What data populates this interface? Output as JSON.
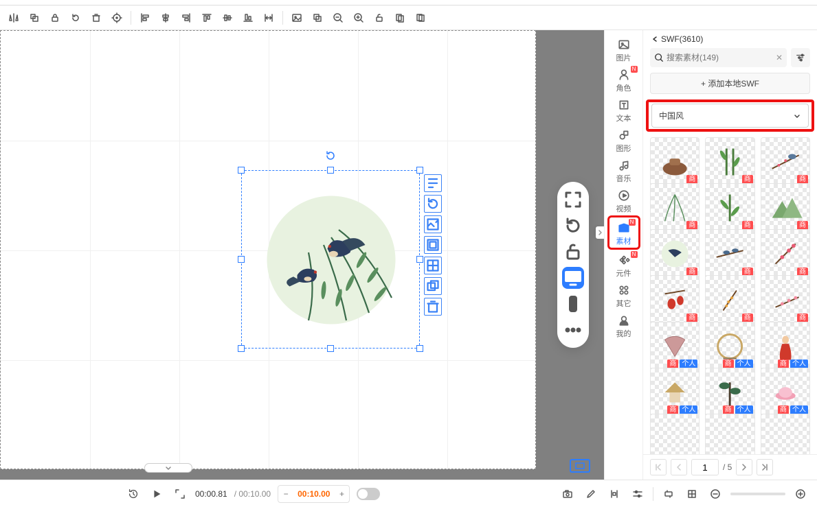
{
  "toolbar_icons": [
    "flip-h",
    "send-back",
    "lock-a",
    "refresh",
    "trash",
    "target",
    "spacer",
    "align-left",
    "align-hcenter",
    "align-right",
    "align-top",
    "align-vcenter",
    "align-bottom",
    "dist-equal",
    "spacer",
    "image",
    "bring-front",
    "zoom-out",
    "zoom-in",
    "unlock",
    "copy",
    "layers"
  ],
  "categories": [
    {
      "key": "image",
      "label": "图片",
      "n": false
    },
    {
      "key": "role",
      "label": "角色",
      "n": true
    },
    {
      "key": "text",
      "label": "文本",
      "n": false
    },
    {
      "key": "shape",
      "label": "图形",
      "n": false
    },
    {
      "key": "music",
      "label": "音乐",
      "n": false
    },
    {
      "key": "video",
      "label": "视频",
      "n": false
    },
    {
      "key": "asset",
      "label": "素材",
      "n": true,
      "active": true,
      "highlight": true
    },
    {
      "key": "component",
      "label": "元件",
      "n": true
    },
    {
      "key": "other",
      "label": "其它",
      "n": false
    },
    {
      "key": "mine",
      "label": "我的",
      "n": false
    }
  ],
  "panel": {
    "back_title": "SWF(3610)",
    "search_placeholder": "搜索素材(149)",
    "add_label": "+ 添加本地SWF",
    "style_select": "中国风",
    "badges": {
      "com": "商",
      "per": "个人"
    },
    "thumbs": [
      {
        "t": "teapot",
        "b": [
          "com"
        ]
      },
      {
        "t": "bamboo",
        "b": [
          "com"
        ]
      },
      {
        "t": "bird-plum",
        "b": [
          "com"
        ]
      },
      {
        "t": "willow",
        "b": [
          "com"
        ]
      },
      {
        "t": "bamboo2",
        "b": [
          "com"
        ]
      },
      {
        "t": "mountain",
        "b": [
          "com"
        ]
      },
      {
        "t": "swallow",
        "b": [
          "com"
        ]
      },
      {
        "t": "birds-branch",
        "b": [
          "com"
        ]
      },
      {
        "t": "plum2",
        "b": [
          "com"
        ]
      },
      {
        "t": "lantern",
        "b": [
          "com"
        ]
      },
      {
        "t": "osmanthus",
        "b": [
          "com"
        ]
      },
      {
        "t": "plum3",
        "b": [
          "com"
        ]
      },
      {
        "t": "fan",
        "b": [
          "com",
          "per"
        ]
      },
      {
        "t": "moon-gate",
        "b": [
          "com",
          "per"
        ]
      },
      {
        "t": "lady",
        "b": [
          "com",
          "per"
        ]
      },
      {
        "t": "pavilion",
        "b": [
          "com",
          "per"
        ]
      },
      {
        "t": "pine",
        "b": [
          "com",
          "per"
        ]
      },
      {
        "t": "lotus",
        "b": [
          "com",
          "per"
        ]
      },
      {
        "t": "blank",
        "b": []
      },
      {
        "t": "blank",
        "b": []
      },
      {
        "t": "blank",
        "b": []
      }
    ],
    "pager": {
      "current": "1",
      "total": "/ 5"
    }
  },
  "timeline": {
    "current": "00:00.81",
    "total": "/ 00:10.00",
    "pill": "00:10.00"
  },
  "pill_icons": [
    "fullscreen",
    "rotate",
    "unlock",
    "display",
    "tablet",
    "more"
  ],
  "elem_icons": [
    "edit",
    "rotate",
    "replace-img",
    "crop",
    "align-stage",
    "order",
    "trash"
  ]
}
